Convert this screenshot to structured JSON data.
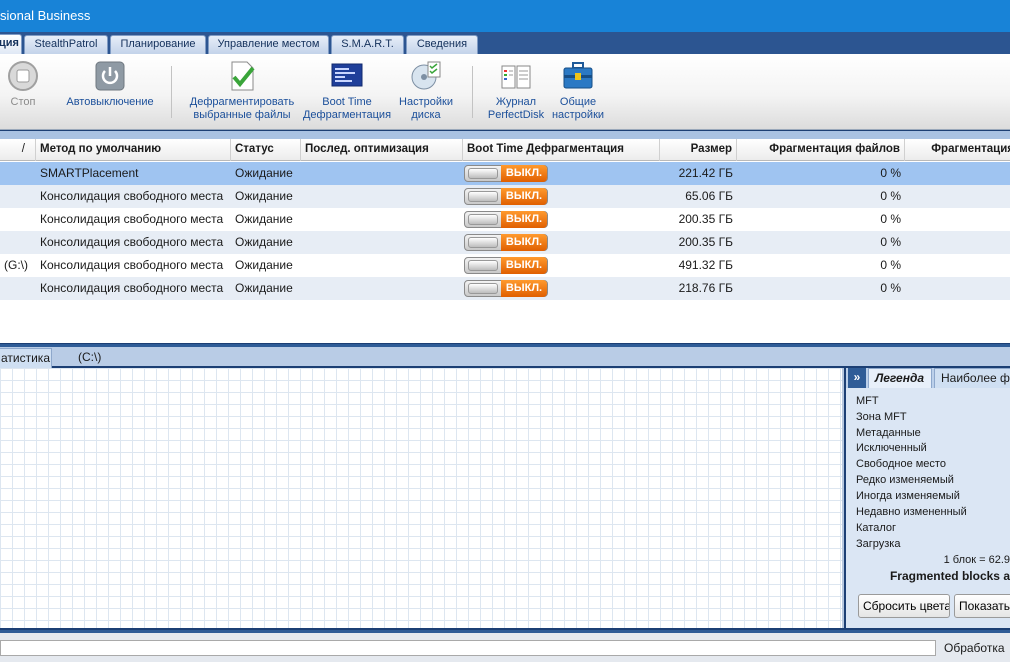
{
  "window": {
    "title": "sional Business"
  },
  "tabs": [
    {
      "label": "ция",
      "active": true
    },
    {
      "label": "StealthPatrol"
    },
    {
      "label": "Планирование"
    },
    {
      "label": "Управление местом"
    },
    {
      "label": "S.M.A.R.T."
    },
    {
      "label": "Сведения"
    }
  ],
  "toolbar": {
    "stop": "Стоп",
    "auto_shutdown": "Автовыключение",
    "defrag_selected_1": "Дефрагментировать",
    "defrag_selected_2": "выбранные файлы",
    "boot_time_1": "Boot Time",
    "boot_time_2": "Дефрагментация",
    "disk_settings_1": "Настройки",
    "disk_settings_2": "диска",
    "journal_1": "Журнал",
    "journal_2": "PerfectDisk",
    "general_settings_1": "Общие",
    "general_settings_2": "настройки"
  },
  "table": {
    "columns": {
      "sort": "/",
      "method": "Метод по умолчанию",
      "status": "Статус",
      "last_opt": "Послед. оптимизация",
      "boot_time": "Boot Time Дефрагментация",
      "size": "Размер",
      "file_frag": "Фрагментация файлов",
      "frag": "Фрагментация"
    },
    "rows": [
      {
        "drive": "",
        "method": "SMARTPlacement",
        "status": "Ожидание",
        "last_opt": "",
        "boot": "ВЫКЛ.",
        "size": "221.42 ГБ",
        "file_frag": "0 %"
      },
      {
        "drive": "",
        "method": "Консолидация свободного места",
        "status": "Ожидание",
        "last_opt": "",
        "boot": "ВЫКЛ.",
        "size": "65.06 ГБ",
        "file_frag": "0 %"
      },
      {
        "drive": "",
        "method": "Консолидация свободного места",
        "status": "Ожидание",
        "last_opt": "",
        "boot": "ВЫКЛ.",
        "size": "200.35 ГБ",
        "file_frag": "0 %"
      },
      {
        "drive": "",
        "method": "Консолидация свободного места",
        "status": "Ожидание",
        "last_opt": "",
        "boot": "ВЫКЛ.",
        "size": "200.35 ГБ",
        "file_frag": "0 %"
      },
      {
        "drive": "(G:\\)",
        "method": "Консолидация свободного места",
        "status": "Ожидание",
        "last_opt": "",
        "boot": "ВЫКЛ.",
        "size": "491.32 ГБ",
        "file_frag": "0 %"
      },
      {
        "drive": "",
        "method": "Консолидация свободного места",
        "status": "Ожидание",
        "last_opt": "",
        "boot": "ВЫКЛ.",
        "size": "218.76 ГБ",
        "file_frag": "0 %"
      }
    ]
  },
  "lower_tabs": {
    "stats": "атистика",
    "drive": "(C:\\)"
  },
  "legend": {
    "tab_legend": "Легенда",
    "tab_most": "Наиболее фр",
    "items": [
      "MFT",
      "Зона MFT",
      "Метаданные",
      "Исключенный",
      "Свободное место",
      "Редко изменяемый",
      "Иногда изменяемый",
      "Недавно измененный",
      "Каталог",
      "Загрузка"
    ],
    "block_note": "1 блок = 62.9",
    "fragmented_note": "Fragmented blocks a",
    "reset_colors": "Сбросить цвета",
    "show": "Показать"
  },
  "statusbar": {
    "text": "Обработка"
  }
}
